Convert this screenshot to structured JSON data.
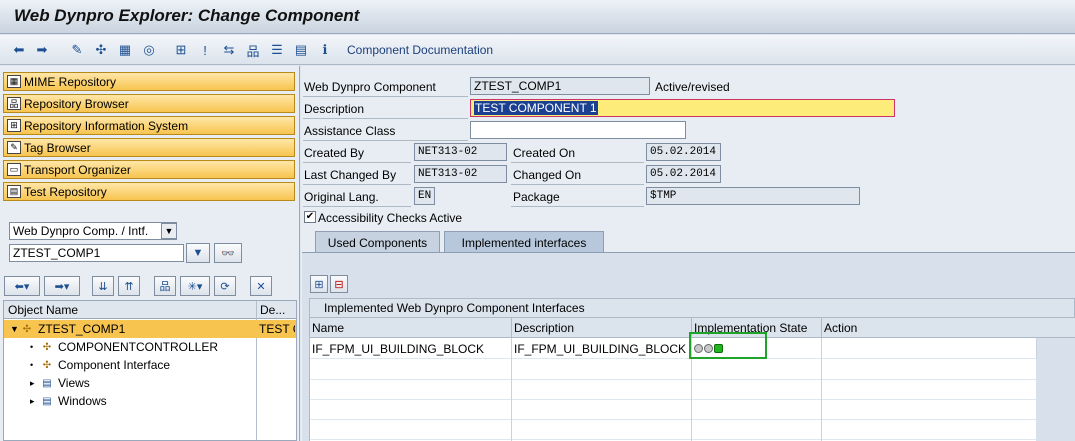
{
  "window": {
    "title": "Web Dynpro Explorer: Change Component"
  },
  "toolbar": {
    "icons": [
      "back-icon",
      "forward-icon",
      "edit-icon",
      "activate-icon",
      "object-list-icon",
      "where-used-icon",
      "display-navigation-icon",
      "enhance-icon",
      "other-object-icon",
      "hierarchy-icon",
      "window-icon",
      "layout-icon",
      "info-icon"
    ],
    "documentation_label": "Component Documentation"
  },
  "nav": {
    "items": [
      {
        "label": "MIME Repository",
        "icon": "mime-icon"
      },
      {
        "label": "Repository Browser",
        "icon": "browser-icon"
      },
      {
        "label": "Repository Information System",
        "icon": "info-system-icon"
      },
      {
        "label": "Tag Browser",
        "icon": "tag-icon"
      },
      {
        "label": "Transport Organizer",
        "icon": "transport-icon"
      },
      {
        "label": "Test Repository",
        "icon": "test-icon"
      }
    ]
  },
  "browser": {
    "object_type": "Web Dynpro Comp. / Intf.",
    "object_name": "ZTEST_COMP1"
  },
  "tree": {
    "col_object": "Object Name",
    "col_desc": "De...",
    "rows": [
      {
        "label": "ZTEST_COMP1",
        "desc": "TEST C",
        "level": 0,
        "toggle": "▼"
      },
      {
        "label": "COMPONENTCONTROLLER",
        "desc": "",
        "level": 1,
        "toggle": "•"
      },
      {
        "label": "Component Interface",
        "desc": "",
        "level": 1,
        "toggle": "•"
      },
      {
        "label": "Views",
        "desc": "",
        "level": 1,
        "toggle": "▸"
      },
      {
        "label": "Windows",
        "desc": "",
        "level": 1,
        "toggle": "▸"
      }
    ]
  },
  "form": {
    "component_label": "Web Dynpro Component",
    "component_value": "ZTEST_COMP1",
    "status": "Active/revised",
    "description_label": "Description",
    "description_value": "TEST COMPONENT 1",
    "assistance_label": "Assistance Class",
    "assistance_value": "",
    "created_by_label": "Created By",
    "created_by_value": "NET313-02",
    "created_on_label": "Created On",
    "created_on_value": "05.02.2014",
    "last_changed_by_label": "Last Changed By",
    "last_changed_by_value": "NET313-02",
    "changed_on_label": "Changed On",
    "changed_on_value": "05.02.2014",
    "orig_lang_label": "Original Lang.",
    "orig_lang_value": "EN",
    "package_label": "Package",
    "package_value": "$TMP",
    "accessibility_label": "Accessibility Checks Active",
    "accessibility_checked": true
  },
  "tabs": [
    {
      "label": "Used Components",
      "active": false
    },
    {
      "label": "Implemented interfaces",
      "active": true
    }
  ],
  "interfaces": {
    "title": "Implemented Web Dynpro Component Interfaces",
    "columns": [
      "Name",
      "Description",
      "Implementation State",
      "Action"
    ],
    "rows": [
      {
        "name": "IF_FPM_UI_BUILDING_BLOCK",
        "description": "IF_FPM_UI_BUILDING_BLOCK",
        "state": "green",
        "action": ""
      }
    ]
  },
  "colors": {
    "nav_button": "#f7c44f",
    "highlight_box": "#1fa32a",
    "status_green": "#22b51e"
  }
}
